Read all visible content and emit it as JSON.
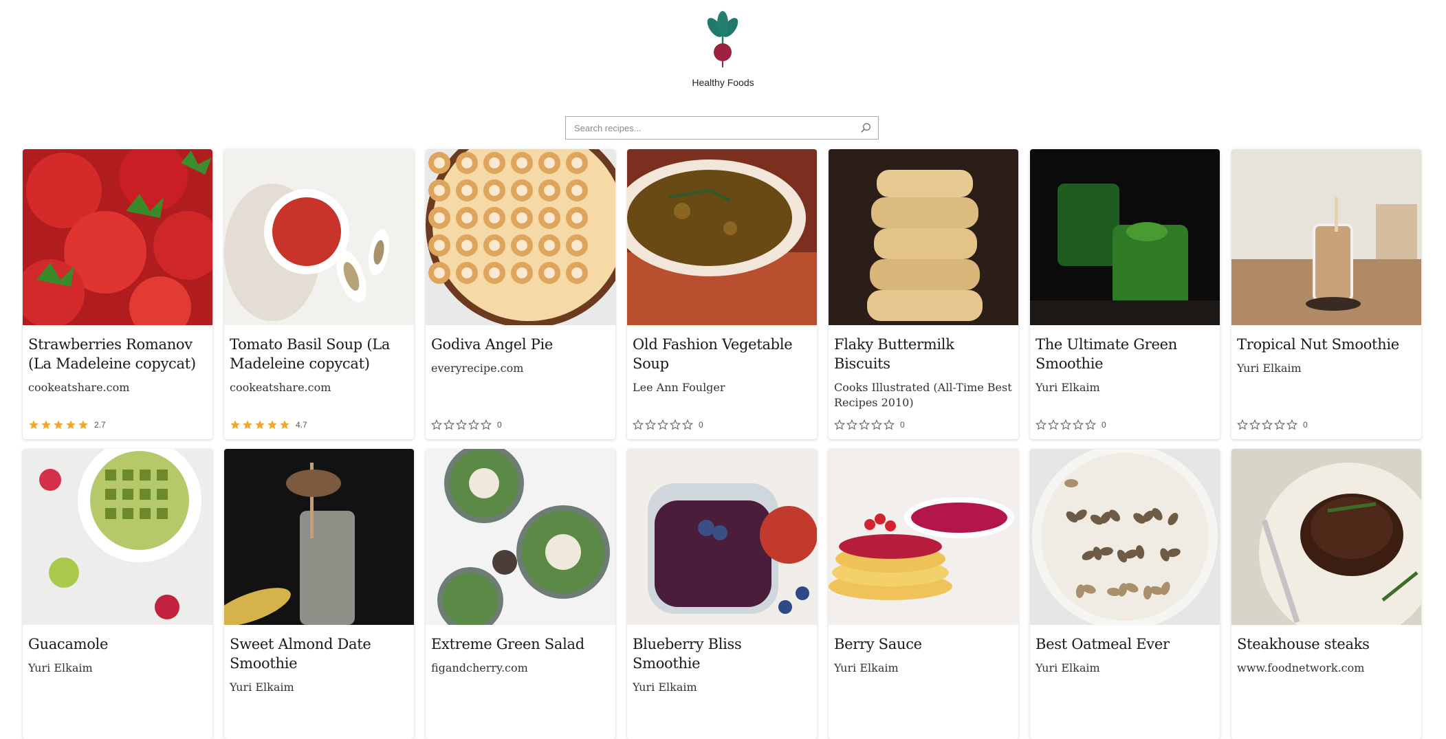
{
  "header": {
    "site_title": "Healthy Foods",
    "logo_icon": "beet-icon"
  },
  "search": {
    "placeholder": "Search recipes...",
    "value": ""
  },
  "colors": {
    "star_filled": "#f4a62a",
    "star_empty": "#666666",
    "leaf": "#1f7a6c",
    "beet": "#9c2242"
  },
  "recipes": [
    {
      "title": "Strawberries Romanov (La Madeleine copycat)",
      "source": "cookeatshare.com",
      "rating": 5,
      "rating_label": "2.7",
      "image": "strawberries"
    },
    {
      "title": "Tomato Basil Soup (La Madeleine copycat)",
      "source": "cookeatshare.com",
      "rating": 5,
      "rating_label": "4.7",
      "image": "tomato-soup"
    },
    {
      "title": "Godiva Angel Pie",
      "source": "everyrecipe.com",
      "rating": 0,
      "rating_label": "0",
      "image": "meringue-pie"
    },
    {
      "title": "Old Fashion Vegetable Soup",
      "source": "Lee Ann Foulger",
      "rating": 0,
      "rating_label": "0",
      "image": "vegetable-soup"
    },
    {
      "title": "Flaky Buttermilk Biscuits",
      "source": "Cooks Illustrated (All-Time Best Recipes 2010)",
      "rating": 0,
      "rating_label": "0",
      "image": "biscuits"
    },
    {
      "title": "The Ultimate Green Smoothie",
      "source": "Yuri Elkaim",
      "rating": 0,
      "rating_label": "0",
      "image": "green-smoothie"
    },
    {
      "title": "Tropical Nut Smoothie",
      "source": "Yuri Elkaim",
      "rating": 0,
      "rating_label": "0",
      "image": "nut-smoothie"
    },
    {
      "title": "Guacamole",
      "source": "Yuri Elkaim",
      "rating": null,
      "rating_label": "",
      "image": "guacamole"
    },
    {
      "title": "Sweet Almond Date Smoothie",
      "source": "Yuri Elkaim",
      "rating": null,
      "rating_label": "",
      "image": "almond-smoothie"
    },
    {
      "title": "Extreme Green Salad",
      "source": "figandcherry.com",
      "rating": null,
      "rating_label": "",
      "image": "green-salad"
    },
    {
      "title": "Blueberry Bliss Smoothie",
      "source": "Yuri Elkaim",
      "rating": null,
      "rating_label": "",
      "image": "blueberry-smoothie"
    },
    {
      "title": "Berry Sauce",
      "source": "Yuri Elkaim",
      "rating": null,
      "rating_label": "",
      "image": "berry-sauce"
    },
    {
      "title": "Best Oatmeal Ever",
      "source": "Yuri Elkaim",
      "rating": null,
      "rating_label": "",
      "image": "oatmeal"
    },
    {
      "title": "Steakhouse steaks",
      "source": "www.foodnetwork.com",
      "rating": null,
      "rating_label": "",
      "image": "steak"
    }
  ]
}
